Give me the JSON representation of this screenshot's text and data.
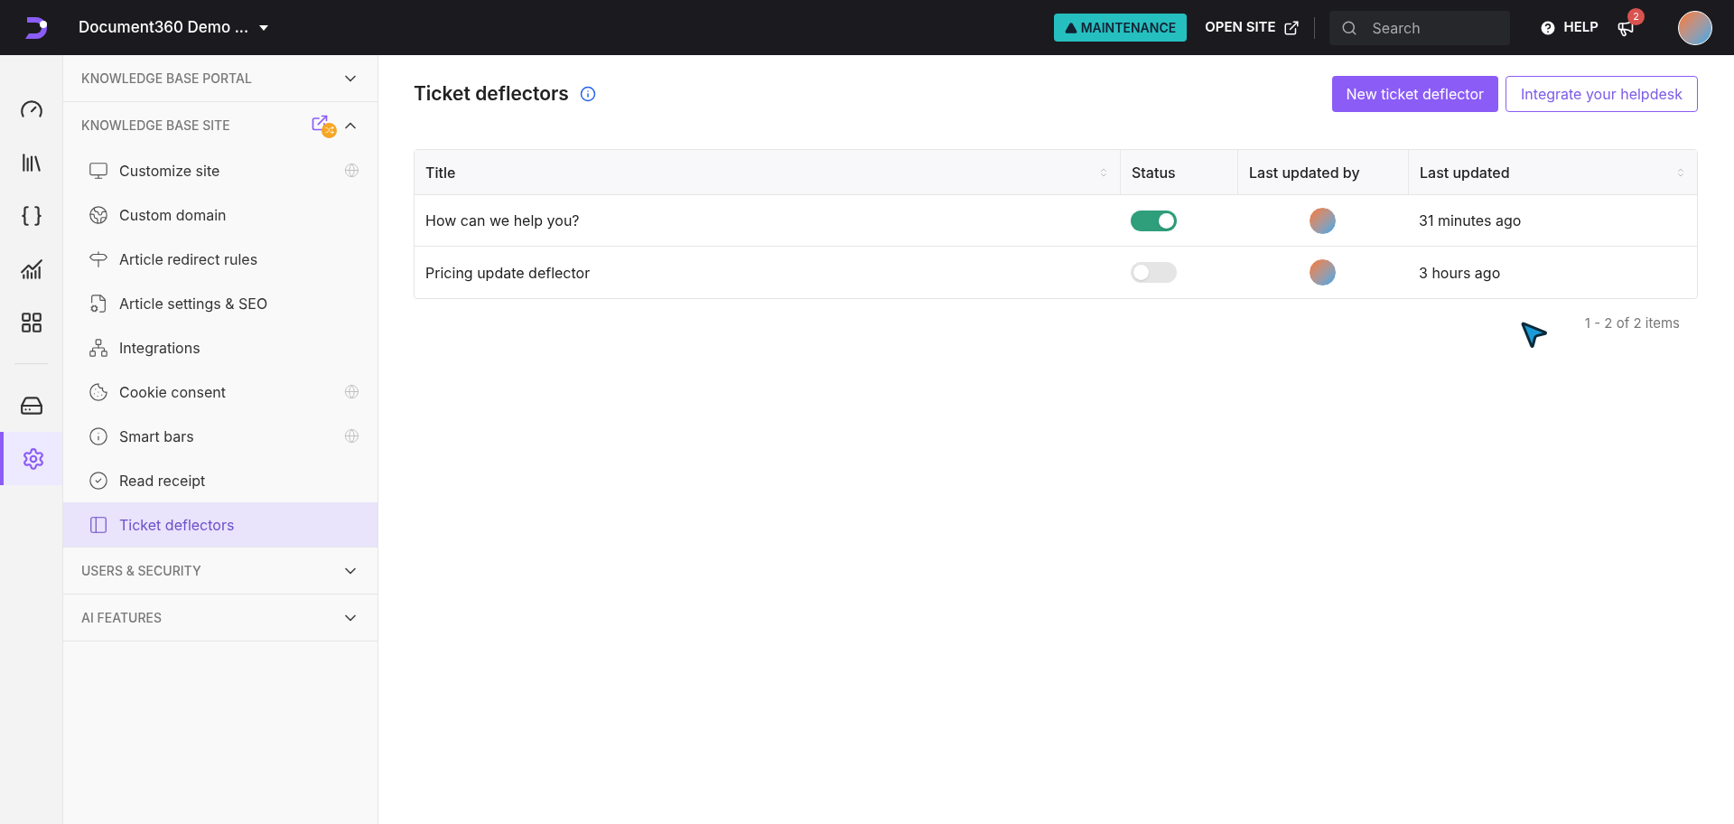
{
  "topbar": {
    "project": "Document360 Demo ...",
    "maintenance": "MAINTENANCE",
    "open_site": "OPEN SITE",
    "search": {
      "placeholder": "Search"
    },
    "help": "HELP",
    "notifications": "2"
  },
  "rail": [
    {
      "kind": "dashboard",
      "selected": false
    },
    {
      "kind": "documentation",
      "selected": false
    },
    {
      "kind": "api",
      "selected": false
    },
    {
      "kind": "analytics",
      "selected": false
    },
    {
      "kind": "apps",
      "selected": false
    },
    {
      "kind": "drive",
      "selected": false
    },
    {
      "kind": "settings",
      "selected": true
    }
  ],
  "sidebar": {
    "sections": [
      {
        "label": "KNOWLEDGE BASE PORTAL",
        "expanded": false
      },
      {
        "label": "KNOWLEDGE BASE SITE",
        "expanded": true,
        "items": [
          {
            "label": "Customize site",
            "kind": "monitor",
            "globe": true,
            "selected": false
          },
          {
            "label": "Custom domain",
            "kind": "domain",
            "globe": false,
            "selected": false
          },
          {
            "label": "Article redirect rules",
            "kind": "redirect",
            "globe": false,
            "selected": false
          },
          {
            "label": "Article settings & SEO",
            "kind": "seo",
            "globe": false,
            "selected": false
          },
          {
            "label": "Integrations",
            "kind": "integrations",
            "globe": false,
            "selected": false
          },
          {
            "label": "Cookie consent",
            "kind": "cookie",
            "globe": true,
            "selected": false
          },
          {
            "label": "Smart bars",
            "kind": "info",
            "globe": true,
            "selected": false
          },
          {
            "label": "Read receipt",
            "kind": "receipt",
            "globe": false,
            "selected": false
          },
          {
            "label": "Ticket deflectors",
            "kind": "deflector",
            "globe": false,
            "selected": true
          }
        ]
      },
      {
        "label": "USERS & SECURITY",
        "expanded": false
      },
      {
        "label": "AI FEATURES",
        "expanded": false
      }
    ]
  },
  "page": {
    "title": "Ticket deflectors",
    "buttons": [
      "New ticket deflector",
      "Integrate your helpdesk"
    ],
    "table": {
      "columns": [
        "Title",
        "Status",
        "Last updated by",
        "Last updated"
      ],
      "rows": [
        {
          "title": "How can we help you?",
          "on": true,
          "updated": "31 minutes ago"
        },
        {
          "title": "Pricing update deflector",
          "on": false,
          "updated": "3 hours ago"
        }
      ]
    },
    "pagination": "1 - 2 of 2 items"
  }
}
